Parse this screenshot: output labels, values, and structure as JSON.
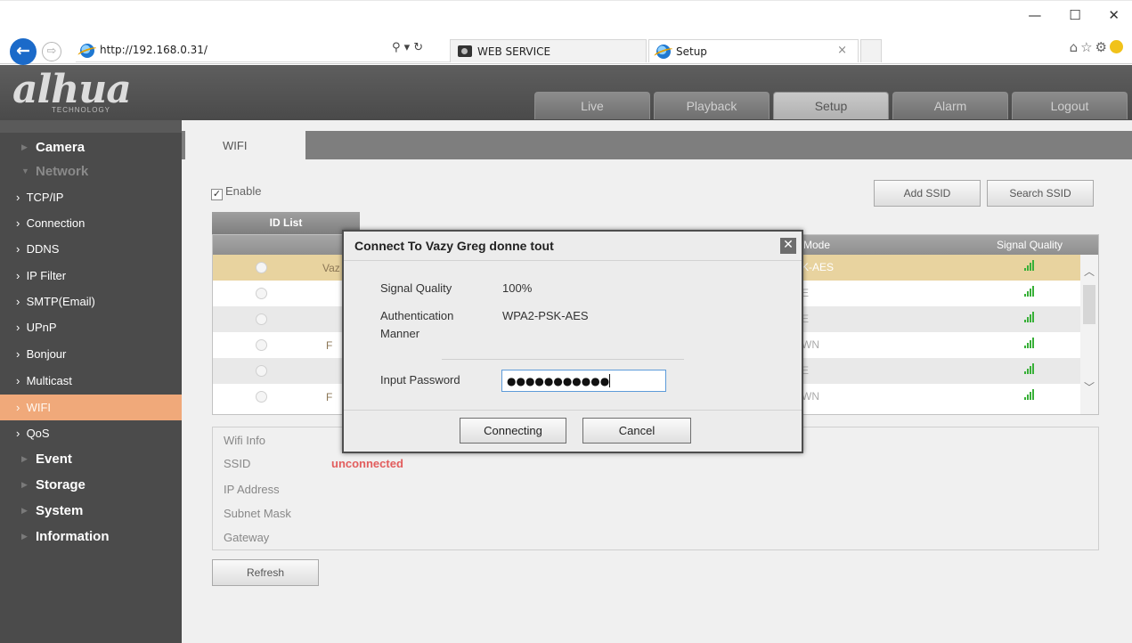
{
  "browser": {
    "url": "http://192.168.0.31/",
    "tabs": [
      {
        "label": "WEB SERVICE",
        "icon": "camera-icon"
      },
      {
        "label": "Setup",
        "icon": "ie-icon"
      }
    ],
    "search_glyph": "⚲ ▾ ↻",
    "close_tab": "×",
    "window_controls": [
      "—",
      "☐",
      "✕"
    ],
    "toolbar_icons": [
      "home-icon",
      "star-icon",
      "gear-icon",
      "smiley-icon"
    ]
  },
  "app": {
    "logo": "alhua",
    "logo_sub": "TECHNOLOGY",
    "nav": [
      "Live",
      "Playback",
      "Setup",
      "Alarm",
      "Logout"
    ],
    "active_nav": "Setup"
  },
  "sidebar": {
    "camera": "Camera",
    "network": "Network",
    "network_items": [
      "TCP/IP",
      "Connection",
      "DDNS",
      "IP Filter",
      "SMTP(Email)",
      "UPnP",
      "Bonjour",
      "Multicast",
      "WIFI",
      "QoS"
    ],
    "event": "Event",
    "storage": "Storage",
    "system": "System",
    "information": "Information",
    "active_item": "WIFI"
  },
  "main": {
    "tab": "WIFI",
    "enable_label": "Enable",
    "enable_checked": true,
    "add_ssid": "Add SSID",
    "search_ssid": "Search SSID",
    "id_list": "ID List",
    "columns": {
      "mode": "Mode",
      "signal": "Signal Quality"
    },
    "rows": [
      {
        "ssid": "Vaz",
        "mode": "K-AES",
        "selected": true
      },
      {
        "ssid": "",
        "mode": "E",
        "selected": false
      },
      {
        "ssid": "",
        "mode": "E",
        "selected": false
      },
      {
        "ssid": "F",
        "mode": "WN",
        "selected": false
      },
      {
        "ssid": "",
        "mode": "E",
        "selected": false
      },
      {
        "ssid": "F",
        "mode": "WN",
        "selected": false
      }
    ],
    "wifi_info": {
      "title": "Wifi Info",
      "ssid_label": "SSID",
      "ssid_value": "unconnected",
      "ip_label": "IP Address",
      "subnet_label": "Subnet Mask",
      "gateway_label": "Gateway"
    },
    "refresh": "Refresh"
  },
  "modal": {
    "title": "Connect To Vazy Greg donne tout",
    "close": "✕",
    "signal_label": "Signal Quality",
    "signal_value": "100%",
    "auth_label": "Authentication Manner",
    "auth_value": "WPA2-PSK-AES",
    "password_label": "Input Password",
    "password_mask": "●●●●●●●●●●●",
    "connect_button": "Connecting",
    "cancel_button": "Cancel"
  }
}
